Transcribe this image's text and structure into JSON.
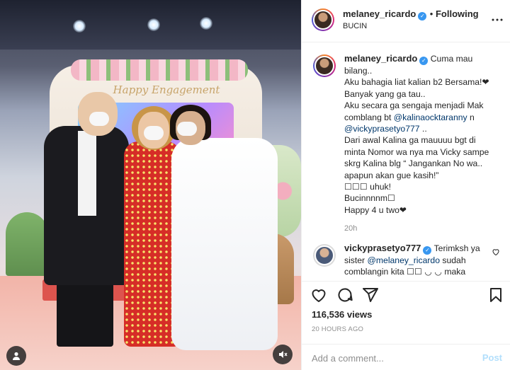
{
  "media": {
    "sign_text": "Happy Engagement"
  },
  "header": {
    "username": "melaney_ricardo",
    "follow_label": "Following",
    "location": "BUCIN"
  },
  "caption": {
    "username": "melaney_ricardo",
    "first_line": "Cuma mau",
    "lines": [
      "bilang..",
      "Aku bahagia liat kalian b2 Bersama!❤",
      "Banyak yang ga tau..",
      "Aku secara ga sengaja menjadi Mak",
      "comblang bt ",
      "",
      "Dari awal Kalina ga mauuuu bgt di",
      "minta Nomor wa nya ma Vicky sampe",
      "skrg Kalina blg “ Jangankan No wa..",
      "apapun akan gue kasih!”",
      "\u0000 uhuk!",
      "Bucinnnnm\u0000",
      "Happy 4 u two❤"
    ],
    "mention_1": "@kalinaocktaranny",
    "mention_1_suffix": " n",
    "mention_2": "@vickyprasetyo777",
    "mention_2_suffix": " ..",
    "line_comblang": "comblang bt ",
    "line_uhuk": "☐☐☐ uhuk!",
    "line_bucin": "Bucinnnnm☐",
    "time": "20h"
  },
  "reply": {
    "username": "vickyprasetyo777",
    "first_line": "Terimksh ya",
    "line2_prefix": "sister ",
    "mention": "@melaney_ricardo",
    "line2_suffix": " sudah",
    "line3": "comblangin kita ☐☐ ◡ ◡  maka"
  },
  "stats": {
    "views": "116,536 views",
    "ago": "20 HOURS AGO"
  },
  "comment_box": {
    "placeholder": "Add a comment...",
    "post_label": "Post"
  },
  "icons": {
    "like": "heart-icon",
    "comment": "comment-icon",
    "share": "share-icon",
    "save": "bookmark-icon",
    "more": "more-icon",
    "user_tag": "user-tag-icon",
    "sound": "speaker-muted-icon",
    "reply_like": "small-heart-icon"
  },
  "colors": {
    "link": "#00376b",
    "verified": "#3897f0",
    "post_disabled": "#b2dffc",
    "muted": "#8e8e8e"
  }
}
